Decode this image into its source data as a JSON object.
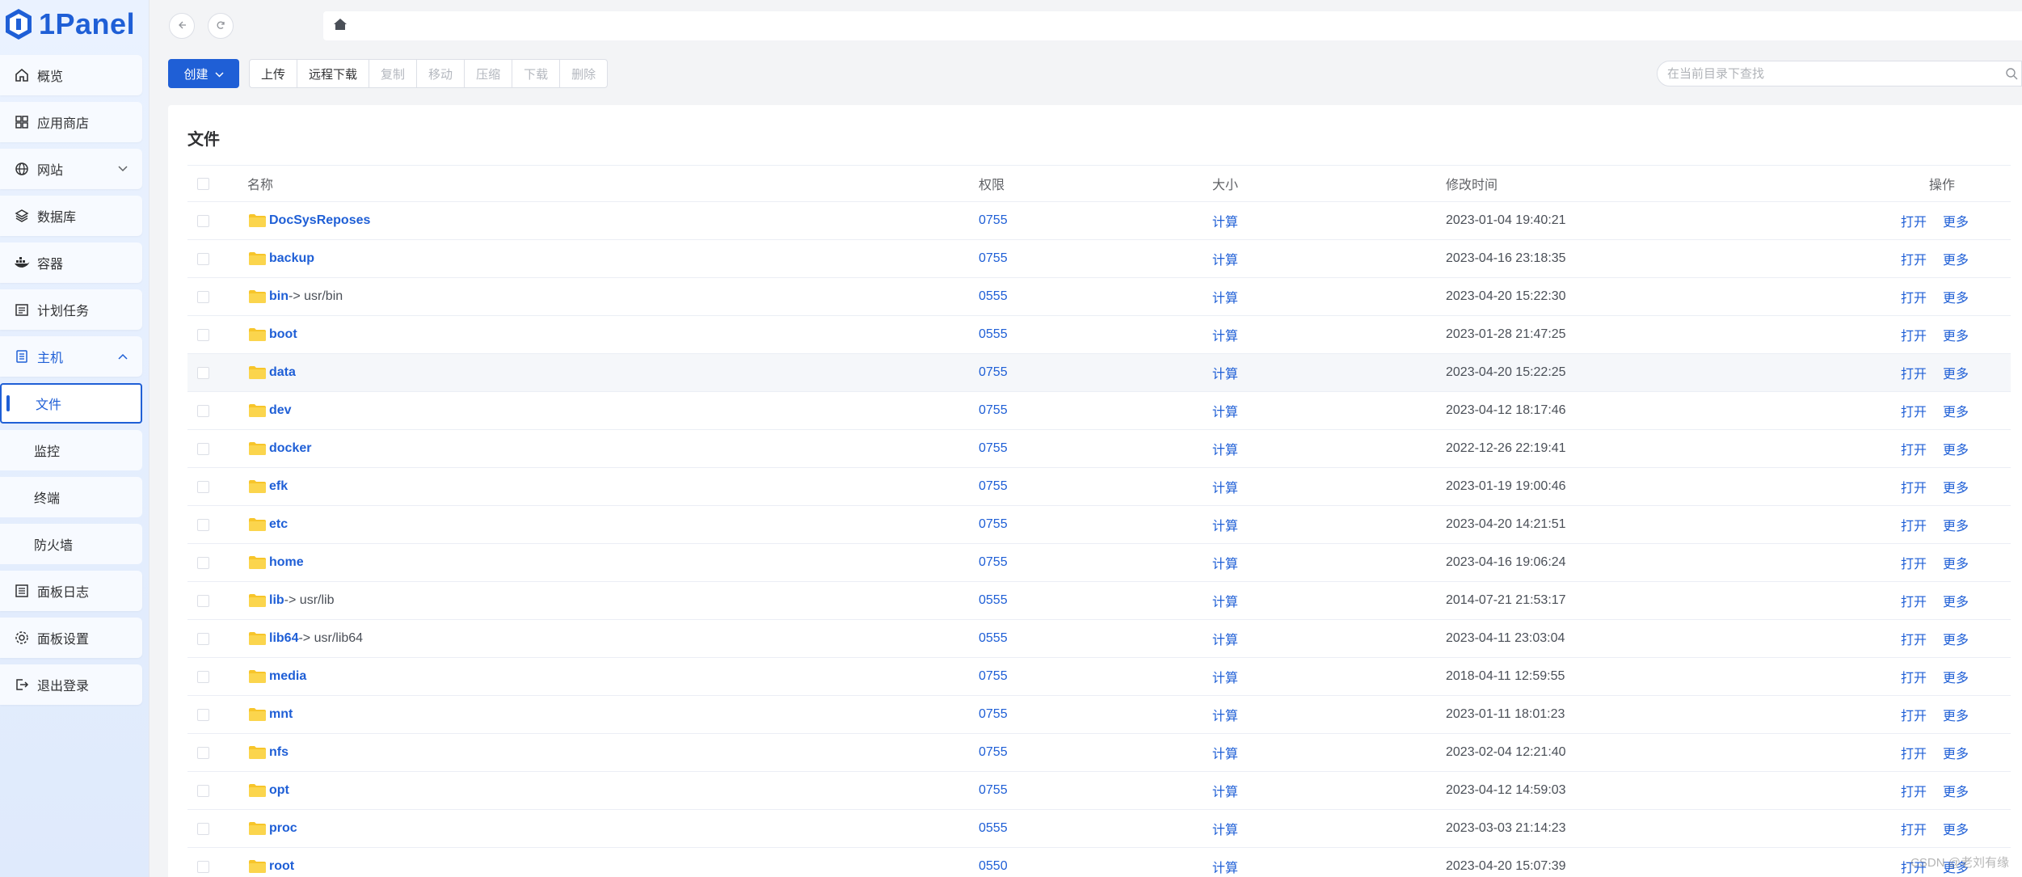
{
  "app": {
    "name": "1Panel"
  },
  "sidebar": {
    "items": [
      {
        "label": "概览",
        "icon": "home-icon"
      },
      {
        "label": "应用商店",
        "icon": "grid-icon"
      },
      {
        "label": "网站",
        "icon": "globe-icon",
        "expandable": true
      },
      {
        "label": "数据库",
        "icon": "layers-icon"
      },
      {
        "label": "容器",
        "icon": "docker-icon"
      },
      {
        "label": "计划任务",
        "icon": "calendar-icon"
      },
      {
        "label": "主机",
        "icon": "host-icon",
        "expanded": true
      },
      {
        "label": "面板日志",
        "icon": "log-icon"
      },
      {
        "label": "面板设置",
        "icon": "gear-icon"
      },
      {
        "label": "退出登录",
        "icon": "logout-icon"
      }
    ],
    "host_sub": [
      {
        "label": "文件",
        "active": true
      },
      {
        "label": "监控"
      },
      {
        "label": "终端"
      },
      {
        "label": "防火墙"
      }
    ]
  },
  "toolbar": {
    "create_label": "创建",
    "buttons": [
      {
        "label": "上传",
        "enabled": true
      },
      {
        "label": "远程下载",
        "enabled": true
      },
      {
        "label": "复制",
        "enabled": false
      },
      {
        "label": "移动",
        "enabled": false
      },
      {
        "label": "压缩",
        "enabled": false
      },
      {
        "label": "下载",
        "enabled": false
      },
      {
        "label": "删除",
        "enabled": false
      }
    ]
  },
  "search": {
    "placeholder": "在当前目录下查找"
  },
  "card": {
    "title": "文件"
  },
  "table": {
    "headers": {
      "name": "名称",
      "perm": "权限",
      "size": "大小",
      "time": "修改时间",
      "ops": "操作"
    },
    "size_action": "计算",
    "op_open": "打开",
    "op_more": "更多",
    "rows": [
      {
        "name": "DocSysReposes",
        "link": "",
        "perm": "0755",
        "time": "2023-01-04 19:40:21"
      },
      {
        "name": "backup",
        "link": "",
        "perm": "0755",
        "time": "2023-04-16 23:18:35"
      },
      {
        "name": "bin",
        "link": "-> usr/bin",
        "perm": "0555",
        "time": "2023-04-20 15:22:30"
      },
      {
        "name": "boot",
        "link": "",
        "perm": "0555",
        "time": "2023-01-28 21:47:25"
      },
      {
        "name": "data",
        "link": "",
        "perm": "0755",
        "time": "2023-04-20 15:22:25"
      },
      {
        "name": "dev",
        "link": "",
        "perm": "0755",
        "time": "2023-04-12 18:17:46"
      },
      {
        "name": "docker",
        "link": "",
        "perm": "0755",
        "time": "2022-12-26 22:19:41"
      },
      {
        "name": "efk",
        "link": "",
        "perm": "0755",
        "time": "2023-01-19 19:00:46"
      },
      {
        "name": "etc",
        "link": "",
        "perm": "0755",
        "time": "2023-04-20 14:21:51"
      },
      {
        "name": "home",
        "link": "",
        "perm": "0755",
        "time": "2023-04-16 19:06:24"
      },
      {
        "name": "lib",
        "link": "-> usr/lib",
        "perm": "0555",
        "time": "2014-07-21 21:53:17"
      },
      {
        "name": "lib64",
        "link": "-> usr/lib64",
        "perm": "0555",
        "time": "2023-04-11 23:03:04"
      },
      {
        "name": "media",
        "link": "",
        "perm": "0755",
        "time": "2018-04-11 12:59:55"
      },
      {
        "name": "mnt",
        "link": "",
        "perm": "0755",
        "time": "2023-01-11 18:01:23"
      },
      {
        "name": "nfs",
        "link": "",
        "perm": "0755",
        "time": "2023-02-04 12:21:40"
      },
      {
        "name": "opt",
        "link": "",
        "perm": "0755",
        "time": "2023-04-12 14:59:03"
      },
      {
        "name": "proc",
        "link": "",
        "perm": "0555",
        "time": "2023-03-03 21:14:23"
      },
      {
        "name": "root",
        "link": "",
        "perm": "0550",
        "time": "2023-04-20 15:07:39"
      }
    ]
  },
  "watermark": "CSDN @老刘有缘",
  "colors": {
    "accent": "#1f5fd6",
    "folder": "#f7c52a"
  }
}
